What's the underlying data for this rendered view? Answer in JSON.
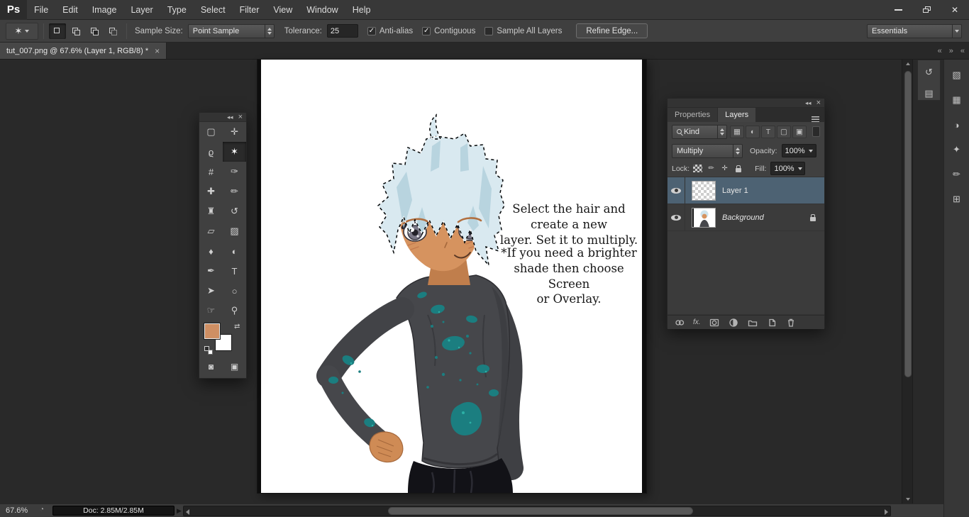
{
  "window": {
    "close_glyph": "✕"
  },
  "menu_bar": {
    "logo": "Ps",
    "items": [
      "File",
      "Edit",
      "Image",
      "Layer",
      "Type",
      "Select",
      "Filter",
      "View",
      "Window",
      "Help"
    ]
  },
  "options_bar": {
    "tool_glyph": "✶",
    "sample_size_label": "Sample Size:",
    "s ample_size_value_note": "",
    "sample_size_value": "Point Sample",
    "tolerance_label": "Tolerance:",
    "tolerance_value": "25",
    "checkboxes": [
      {
        "label": "Anti-alias",
        "mark": "✓"
      },
      {
        "label": "Contiguous",
        "mark": "✓"
      },
      {
        "label": "Sample All Layers",
        "mark": ""
      }
    ],
    "refine_edge_label": "Refine Edge...",
    "workspace_value": "Essentials"
  },
  "tab_bar": {
    "document_title": "tut_007.png @ 67.6% (Layer 1, RGB/8) *",
    "tab_close_glyph": "×",
    "scroll_left_glyph": "«",
    "scroll_right_glyph": "»",
    "dock_collapse_glyph": "«"
  },
  "canvas": {
    "annotation_1": "Select the hair and create a new\nlayer. Set it to multiply.",
    "annotation_2": "*If you need a brighter\nshade then choose Screen\nor Overlay."
  },
  "tools": [
    {
      "name": "rectangular-marquee",
      "glyph": "▢"
    },
    {
      "name": "move",
      "glyph": "✛"
    },
    {
      "name": "lasso",
      "glyph": "ϱ"
    },
    {
      "name": "magic-wand",
      "glyph": "✶"
    },
    {
      "name": "crop",
      "glyph": "#"
    },
    {
      "name": "eyedropper",
      "glyph": "✑"
    },
    {
      "name": "spot-healing-brush",
      "glyph": "✚"
    },
    {
      "name": "brush",
      "glyph": "✏"
    },
    {
      "name": "clone-stamp",
      "glyph": "♜"
    },
    {
      "name": "history-brush",
      "glyph": "↺"
    },
    {
      "name": "eraser",
      "glyph": "▱"
    },
    {
      "name": "gradient",
      "glyph": "▨"
    },
    {
      "name": "blur",
      "glyph": "♦"
    },
    {
      "name": "dodge",
      "glyph": "◐"
    },
    {
      "name": "pen",
      "glyph": "✒"
    },
    {
      "name": "horizontal-type",
      "glyph": "T"
    },
    {
      "name": "path-selection",
      "glyph": "➤"
    },
    {
      "name": "ellipse",
      "glyph": "○"
    },
    {
      "name": "hand",
      "glyph": "☞"
    },
    {
      "name": "zoom",
      "glyph": "⚲"
    }
  ],
  "tools_panel": {
    "collapse_glyph": "◂◂",
    "close_glyph": "×",
    "swap_colors_glyph": "⇄",
    "foreground_color": "#cf8f63",
    "background_color": "#ffffff",
    "quick_mask_glyph": "◙",
    "screen_mode_glyph": "▣"
  },
  "layers_panel": {
    "collapse_glyph": "◂◂",
    "close_glyph": "×",
    "tab_properties": "Properties",
    "tab_layers": "Layers",
    "filter_label": "Kind",
    "filter_icons": [
      {
        "name": "filter-pixel-layers",
        "glyph": "▦"
      },
      {
        "name": "filter-adjustment-layers",
        "glyph": "◐"
      },
      {
        "name": "filter-type-layers",
        "glyph": "T"
      },
      {
        "name": "filter-shape-layers",
        "glyph": "▢"
      },
      {
        "name": "filter-smart-objects",
        "glyph": "▣"
      }
    ],
    "blend_mode_value": "Multiply",
    "opacity_label": "Opacity:",
    "opacity_value": "100%",
    "lock_label": "Lock:",
    "fill_label": "Fill:",
    "fill_value": "100%",
    "layers": [
      {
        "name": "Layer 1"
      },
      {
        "name": "Background"
      }
    ],
    "fx_label": "fx."
  },
  "right_dock": {
    "strip_a": [
      {
        "name": "history",
        "glyph": "↺"
      },
      {
        "name": "navigator",
        "glyph": "▤"
      }
    ],
    "strip_b": [
      {
        "name": "color",
        "glyph": "▧"
      },
      {
        "name": "swatches",
        "glyph": "▦"
      },
      {
        "name": "adjustments",
        "glyph": "◑"
      },
      {
        "name": "styles",
        "glyph": "✦"
      },
      {
        "name": "brush-panel",
        "glyph": "✏"
      },
      {
        "name": "clone-source",
        "glyph": "⊞"
      }
    ]
  },
  "status_bar": {
    "zoom_value": "67.6%",
    "doc_info": "Doc: 2.85M/2.85M",
    "expand_glyph": "▶"
  }
}
